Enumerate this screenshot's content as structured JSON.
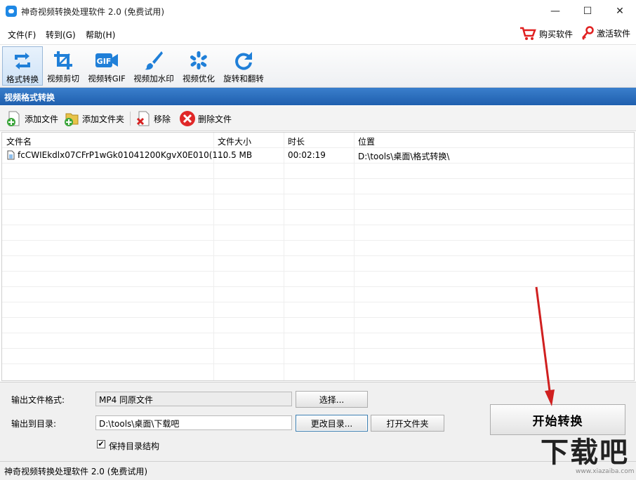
{
  "window": {
    "title": "神奇视频转换处理软件 2.0 (免费试用)",
    "minimize": "—",
    "maximize": "☐",
    "close": "✕"
  },
  "menu": {
    "items": [
      "文件(F)",
      "转到(G)",
      "帮助(H)"
    ],
    "buy": "购买软件",
    "activate": "激活软件"
  },
  "toolbar": {
    "tools": [
      "格式转换",
      "视频剪切",
      "视频转GIF",
      "视频加水印",
      "视频优化",
      "旋转和翻转"
    ],
    "gif_icon_text": "GIF",
    "accent": "#1f7fd8"
  },
  "section": {
    "title": "视频格式转换"
  },
  "actions": {
    "add_file": "添加文件",
    "add_folder": "添加文件夹",
    "remove": "移除",
    "delete_file": "删除文件"
  },
  "file_table": {
    "columns": [
      "文件名",
      "文件大小",
      "时长",
      "位置"
    ],
    "rows": [
      [
        "fcCWIEkdlx07CFrP1wGk01041200KgvX0E010(1...",
        "10.5 MB",
        "00:02:19",
        "D:\\tools\\桌面\\格式转换\\"
      ]
    ]
  },
  "output": {
    "format_label": "输出文件格式:",
    "format_value": "MP4 同原文件",
    "choose_button": "选择...",
    "dir_label": "输出到目录:",
    "dir_value": "D:\\tools\\桌面\\下载吧",
    "change_dir_button": "更改目录...",
    "open_folder_button": "打开文件夹",
    "keep_structure_label": "保持目录结构",
    "keep_structure_checked": "✔",
    "start_button": "开始转换"
  },
  "status": {
    "text": "神奇视频转换处理软件 2.0 (免费试用)"
  },
  "watermark": {
    "text": "下载吧",
    "url": "www.xiazaiba.com"
  }
}
